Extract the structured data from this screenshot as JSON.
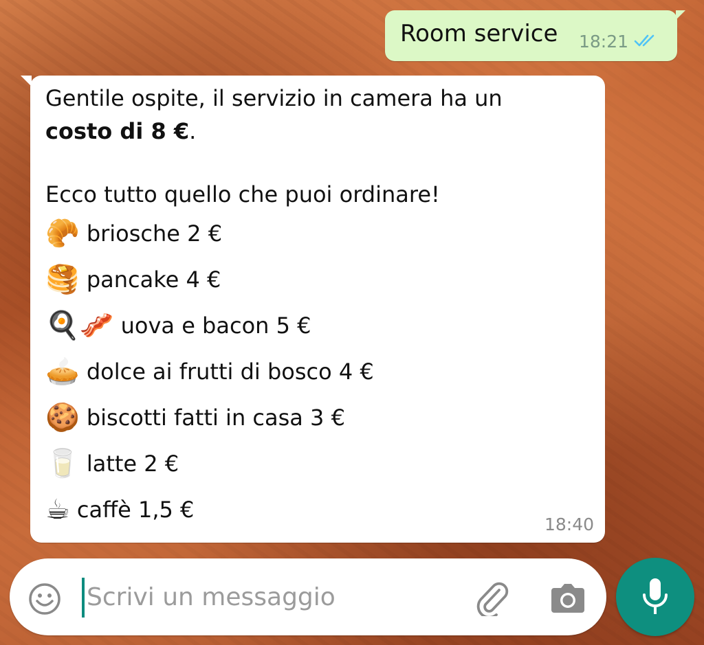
{
  "outgoing": {
    "text": "Room service",
    "time": "18:21",
    "status_icon": "double-check-icon",
    "ticks_color": "#4fc3f7"
  },
  "incoming": {
    "line1": "Gentile ospite, il servizio in camera ha un",
    "line2_bold": "costo di 8 €",
    "line2_rest": ".",
    "line3": "Ecco tutto quello che puoi ordinare!",
    "items": [
      {
        "icon": "🥐",
        "icon_name": "croissant-icon",
        "label": "briosche 2 €"
      },
      {
        "icon": "🥞",
        "icon_name": "pancakes-icon",
        "label": "pancake 4 €"
      },
      {
        "icon": "🍳🥓",
        "icon_name": "egg-bacon-icon",
        "label": "uova e bacon 5 €"
      },
      {
        "icon": "🥧",
        "icon_name": "pie-icon",
        "label": "dolce ai frutti di bosco 4 €"
      },
      {
        "icon": "🍪",
        "icon_name": "cookie-icon",
        "label": "biscotti fatti in casa 3 €"
      },
      {
        "icon": "🥛",
        "icon_name": "milk-icon",
        "label": "latte 2 €"
      },
      {
        "icon": "☕",
        "icon_name": "coffee-icon",
        "label": "caffè 1,5 €"
      }
    ],
    "time": "18:40"
  },
  "composer": {
    "placeholder": "Scrivi un messaggio",
    "emoji_icon": "smiley-icon",
    "attach_icon": "paperclip-icon",
    "camera_icon": "camera-icon",
    "mic_icon": "microphone-icon"
  },
  "colors": {
    "outgoing_bubble": "#dcf8c6",
    "incoming_bubble": "#ffffff",
    "accent": "#0e8f7f"
  }
}
